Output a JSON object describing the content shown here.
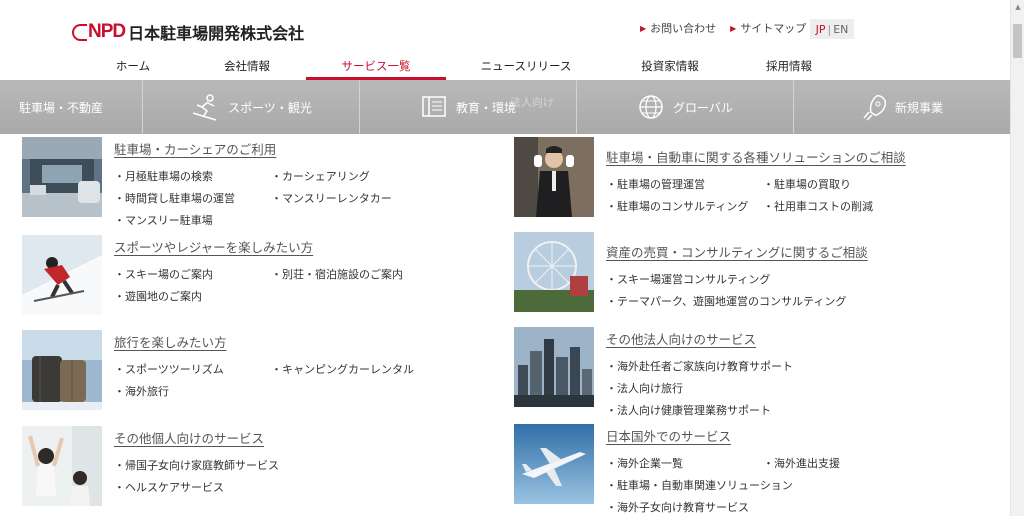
{
  "header": {
    "logo_mark": "NPD",
    "logo_text": "日本駐車場開発株式会社",
    "util_links": [
      "お問い合わせ",
      "サイトマップ"
    ],
    "lang": {
      "jp": "JP",
      "sep": "|",
      "en": "EN"
    }
  },
  "nav": {
    "items": [
      "ホーム",
      "会社情報",
      "サービス一覧",
      "ニュースリリース",
      "投資家情報",
      "採用情報"
    ],
    "active_index": 2
  },
  "submenu": {
    "items": [
      {
        "label": "駐車場・不動産",
        "icon": "none"
      },
      {
        "label": "スポーツ・観光",
        "icon": "skier-icon"
      },
      {
        "label": "教育・環境",
        "icon": "book-icon",
        "ghost": "法人向け"
      },
      {
        "label": "グローバル",
        "icon": "globe-icon"
      },
      {
        "label": "新規事業",
        "icon": "rocket-icon"
      }
    ]
  },
  "left_cards": [
    {
      "title": "駐車場・カーシェアのご利用",
      "photo": "parking-garage",
      "items": [
        "月極駐車場の検索",
        "カーシェアリング",
        "時間貸し駐車場の運営",
        "マンスリーレンタカー",
        "マンスリー駐車場"
      ]
    },
    {
      "title": "スポーツやレジャーを楽しみたい方",
      "photo": "skier",
      "items": [
        "スキー場のご案内",
        "別荘・宿泊施設のご案内",
        "遊園地のご案内"
      ]
    },
    {
      "title": "旅行を楽しみたい方",
      "photo": "suitcases",
      "items": [
        "スポーツツーリズム",
        "キャンピングカーレンタル",
        "海外旅行"
      ]
    },
    {
      "title": "その他個人向けのサービス",
      "photo": "stretching-women",
      "items": [
        "帰国子女向け家庭教師サービス",
        "ヘルスケアサービス"
      ]
    }
  ],
  "right_cards": [
    {
      "title": "駐車場・自動車に関する各種ソリューションのご相談",
      "photo": "parking-attendant",
      "items": [
        "駐車場の管理運営",
        "駐車場の買取り",
        "駐車場のコンサルティング",
        "社用車コストの削減"
      ]
    },
    {
      "title": "資産の売買・コンサルティングに関するご相談",
      "photo": "ferris-wheel",
      "items": [
        "スキー場運営コンサルティング",
        "テーマパーク、遊園地運営のコンサルティング"
      ]
    },
    {
      "title": "その他法人向けのサービス",
      "photo": "city-skyline",
      "items": [
        "海外赴任者ご家族向け教育サポート",
        "法人向け旅行",
        "法人向け健康管理業務サポート"
      ]
    },
    {
      "title": "日本国外でのサービス",
      "photo": "airplane",
      "items": [
        "海外企業一覧",
        "海外進出支援",
        "駐車場・自動車関連ソリューション",
        "海外子女向け教育サービス"
      ]
    }
  ],
  "colors": {
    "accent": "#c8102e",
    "submenu_bg": "#b0b0b0"
  }
}
